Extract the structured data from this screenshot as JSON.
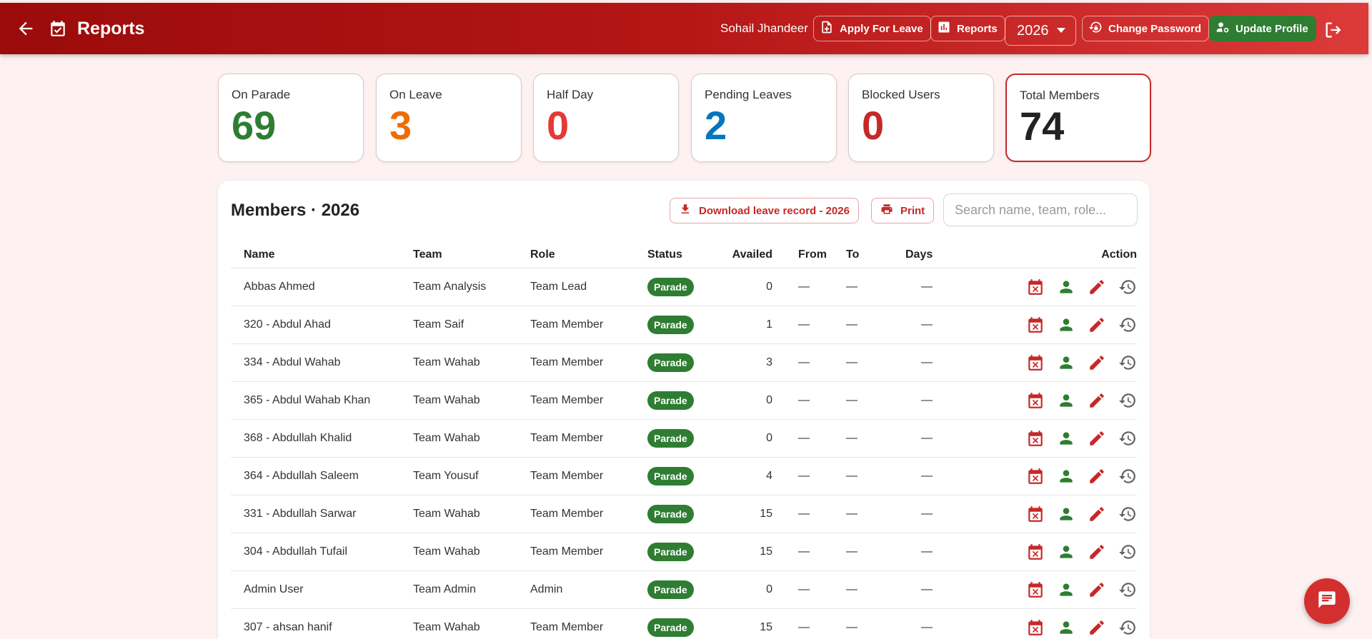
{
  "header": {
    "title": "Reports",
    "user_name": "Sohail Jhandeer",
    "apply_leave_label": "Apply For Leave",
    "reports_label": "Reports",
    "year": "2026",
    "change_password_label": "Change Password",
    "update_profile_label": "Update Profile"
  },
  "stats": [
    {
      "label": "On Parade",
      "value": "69",
      "color": "#2e7d32"
    },
    {
      "label": "On Leave",
      "value": "3",
      "color": "#ef6c00"
    },
    {
      "label": "Half Day",
      "value": "0",
      "color": "#e53935"
    },
    {
      "label": "Pending Leaves",
      "value": "2",
      "color": "#0277bd"
    },
    {
      "label": "Blocked Users",
      "value": "0",
      "color": "#c62828"
    },
    {
      "label": "Total Members",
      "value": "74",
      "color": "#222222"
    }
  ],
  "members": {
    "title": "Members · 2026",
    "download_label": "Download leave record - 2026",
    "print_label": "Print",
    "search_placeholder": "Search name, team, role...",
    "columns": [
      "Name",
      "Team",
      "Role",
      "Status",
      "Availed",
      "From",
      "To",
      "Days",
      "Action"
    ],
    "rows": [
      {
        "name": "Abbas Ahmed",
        "team": "Team Analysis",
        "role": "Team Lead",
        "status": "Parade",
        "availed": "0",
        "from": "—",
        "to": "—",
        "days": "—"
      },
      {
        "name": "320 - Abdul Ahad",
        "team": "Team Saif",
        "role": "Team Member",
        "status": "Parade",
        "availed": "1",
        "from": "—",
        "to": "—",
        "days": "—"
      },
      {
        "name": "334 - Abdul Wahab",
        "team": "Team Wahab",
        "role": "Team Member",
        "status": "Parade",
        "availed": "3",
        "from": "—",
        "to": "—",
        "days": "—"
      },
      {
        "name": "365 - Abdul Wahab Khan",
        "team": "Team Wahab",
        "role": "Team Member",
        "status": "Parade",
        "availed": "0",
        "from": "—",
        "to": "—",
        "days": "—"
      },
      {
        "name": "368 - Abdullah Khalid",
        "team": "Team Wahab",
        "role": "Team Member",
        "status": "Parade",
        "availed": "0",
        "from": "—",
        "to": "—",
        "days": "—"
      },
      {
        "name": "364 - Abdullah Saleem",
        "team": "Team Yousuf",
        "role": "Team Member",
        "status": "Parade",
        "availed": "4",
        "from": "—",
        "to": "—",
        "days": "—"
      },
      {
        "name": "331 - Abdullah Sarwar",
        "team": "Team Wahab",
        "role": "Team Member",
        "status": "Parade",
        "availed": "15",
        "from": "—",
        "to": "—",
        "days": "—"
      },
      {
        "name": "304 - Abdullah Tufail",
        "team": "Team Wahab",
        "role": "Team Member",
        "status": "Parade",
        "availed": "15",
        "from": "—",
        "to": "—",
        "days": "—"
      },
      {
        "name": "Admin User",
        "team": "Team Admin",
        "role": "Admin",
        "status": "Parade",
        "availed": "0",
        "from": "—",
        "to": "—",
        "days": "—"
      },
      {
        "name": "307 - ahsan hanif",
        "team": "Team Wahab",
        "role": "Team Member",
        "status": "Parade",
        "availed": "15",
        "from": "—",
        "to": "—",
        "days": "—"
      }
    ]
  },
  "colors": {
    "brand_red": "#b71c1c",
    "accent_green": "#2e7d32",
    "background": "#fdf1f1"
  },
  "icons": {
    "header": [
      "back-arrow-icon",
      "calendar-check-icon",
      "note-add-icon",
      "bar-chart-icon",
      "lock-reset-icon",
      "manage-accounts-icon",
      "logout-icon"
    ],
    "row_actions": [
      "calendar-cancel-icon",
      "person-icon",
      "edit-pencil-icon",
      "history-icon"
    ],
    "fab": "chat-icon"
  }
}
